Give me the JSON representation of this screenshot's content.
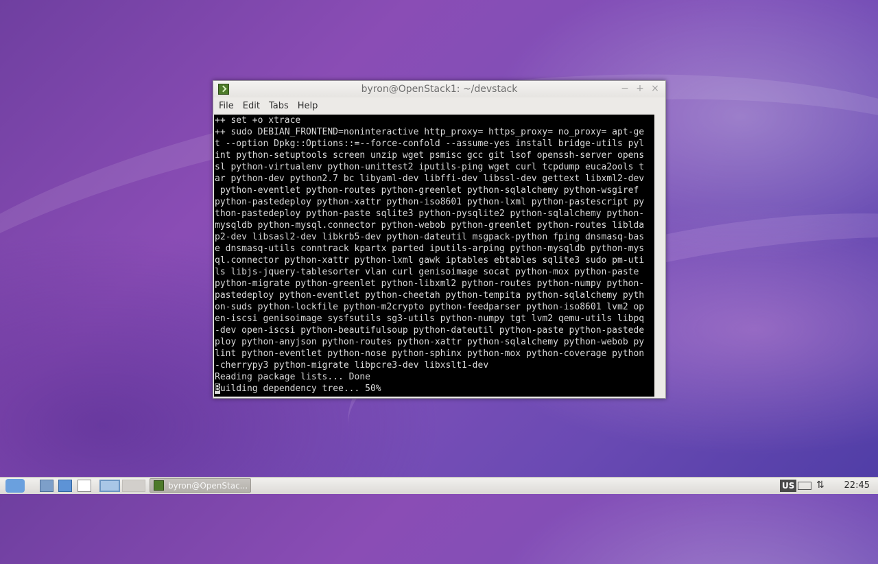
{
  "window": {
    "title": "byron@OpenStack1: ~/devstack",
    "controls": {
      "minimize": "−",
      "maximize": "+",
      "close": "×"
    }
  },
  "menu": [
    "File",
    "Edit",
    "Tabs",
    "Help"
  ],
  "terminal": {
    "lines": [
      "++ set +o xtrace",
      "++ sudo DEBIAN_FRONTEND=noninteractive http_proxy= https_proxy= no_proxy= apt-ge",
      "t --option Dpkg::Options::=--force-confold --assume-yes install bridge-utils pyl",
      "int python-setuptools screen unzip wget psmisc gcc git lsof openssh-server opens",
      "sl python-virtualenv python-unittest2 iputils-ping wget curl tcpdump euca2ools t",
      "ar python-dev python2.7 bc libyaml-dev libffi-dev libssl-dev gettext libxml2-dev",
      " python-eventlet python-routes python-greenlet python-sqlalchemy python-wsgiref",
      "python-pastedeploy python-xattr python-iso8601 python-lxml python-pastescript py",
      "thon-pastedeploy python-paste sqlite3 python-pysqlite2 python-sqlalchemy python-",
      "mysqldb python-mysql.connector python-webob python-greenlet python-routes liblda",
      "p2-dev libsasl2-dev libkrb5-dev python-dateutil msgpack-python fping dnsmasq-bas",
      "e dnsmasq-utils conntrack kpartx parted iputils-arping python-mysqldb python-mys",
      "ql.connector python-xattr python-lxml gawk iptables ebtables sqlite3 sudo pm-uti",
      "ls libjs-jquery-tablesorter vlan curl genisoimage socat python-mox python-paste",
      "python-migrate python-greenlet python-libxml2 python-routes python-numpy python-",
      "pastedeploy python-eventlet python-cheetah python-tempita python-sqlalchemy pyth",
      "on-suds python-lockfile python-m2crypto python-feedparser python-iso8601 lvm2 op",
      "en-iscsi genisoimage sysfsutils sg3-utils python-numpy tgt lvm2 qemu-utils libpq",
      "-dev open-iscsi python-beautifulsoup python-dateutil python-paste python-pastede",
      "ploy python-anyjson python-routes python-xattr python-sqlalchemy python-webob py",
      "lint python-eventlet python-nose python-sphinx python-mox python-coverage python",
      "-cherrypy3 python-migrate libpcre3-dev libxslt1-dev",
      "Reading package lists... Done"
    ],
    "last_line_cursor_char": "B",
    "last_line_rest": "uilding dependency tree... 50%"
  },
  "taskbar": {
    "task_label": "byron@OpenStac...",
    "keyboard_layout": "US",
    "clock": "22:45"
  }
}
